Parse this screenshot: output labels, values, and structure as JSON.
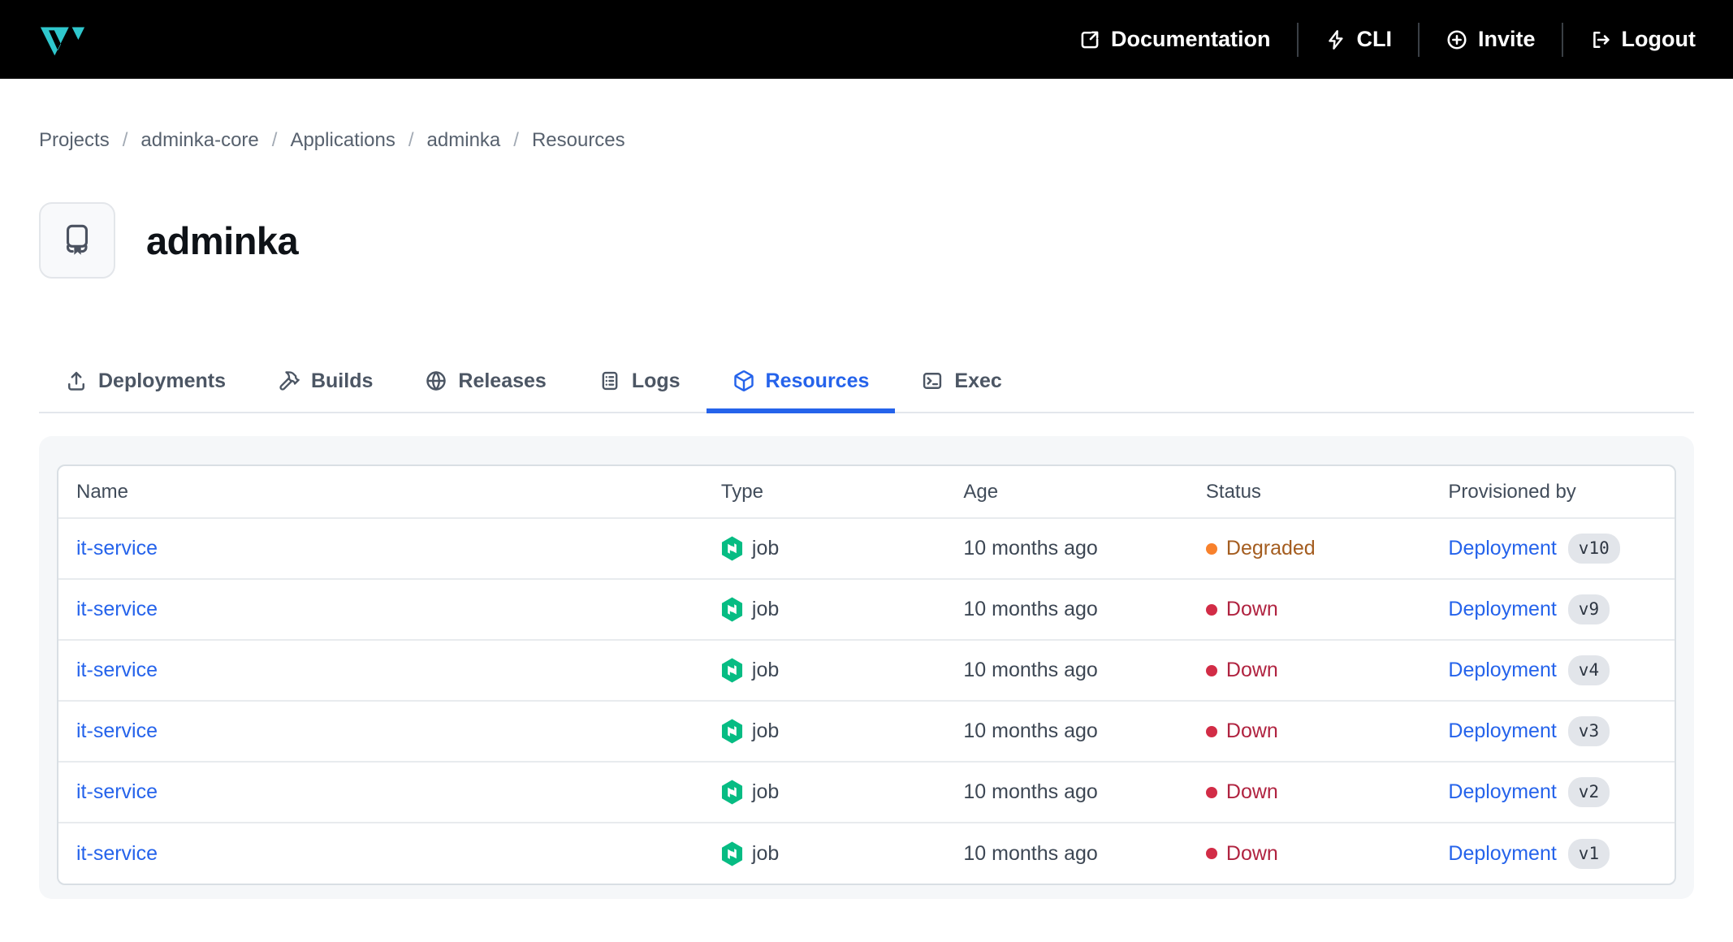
{
  "colors": {
    "accent_blue": "#2563eb",
    "logo_teal": "#2fc7cd",
    "nomad_green": "#06bc83",
    "status": {
      "Degraded": {
        "dot": "#f8812c",
        "text": "#a45d20"
      },
      "Down": {
        "dot": "#d22c46",
        "text": "#b02340"
      }
    }
  },
  "header": {
    "nav": [
      {
        "label": "Documentation"
      },
      {
        "label": "CLI"
      },
      {
        "label": "Invite"
      },
      {
        "label": "Logout"
      }
    ]
  },
  "breadcrumb": {
    "separator": "/",
    "items": [
      "Projects",
      "adminka-core",
      "Applications",
      "adminka",
      "Resources"
    ]
  },
  "page": {
    "title": "adminka"
  },
  "tabs": [
    {
      "label": "Deployments",
      "active": false
    },
    {
      "label": "Builds",
      "active": false
    },
    {
      "label": "Releases",
      "active": false
    },
    {
      "label": "Logs",
      "active": false
    },
    {
      "label": "Resources",
      "active": true
    },
    {
      "label": "Exec",
      "active": false
    }
  ],
  "table": {
    "columns": [
      "Name",
      "Type",
      "Age",
      "Status",
      "Provisioned by"
    ],
    "rows": [
      {
        "name": "it-service",
        "type": "job",
        "age": "10 months ago",
        "status": "Degraded",
        "provisioned_by": "Deployment",
        "version": "v10"
      },
      {
        "name": "it-service",
        "type": "job",
        "age": "10 months ago",
        "status": "Down",
        "provisioned_by": "Deployment",
        "version": "v9"
      },
      {
        "name": "it-service",
        "type": "job",
        "age": "10 months ago",
        "status": "Down",
        "provisioned_by": "Deployment",
        "version": "v4"
      },
      {
        "name": "it-service",
        "type": "job",
        "age": "10 months ago",
        "status": "Down",
        "provisioned_by": "Deployment",
        "version": "v3"
      },
      {
        "name": "it-service",
        "type": "job",
        "age": "10 months ago",
        "status": "Down",
        "provisioned_by": "Deployment",
        "version": "v2"
      },
      {
        "name": "it-service",
        "type": "job",
        "age": "10 months ago",
        "status": "Down",
        "provisioned_by": "Deployment",
        "version": "v1"
      }
    ]
  }
}
